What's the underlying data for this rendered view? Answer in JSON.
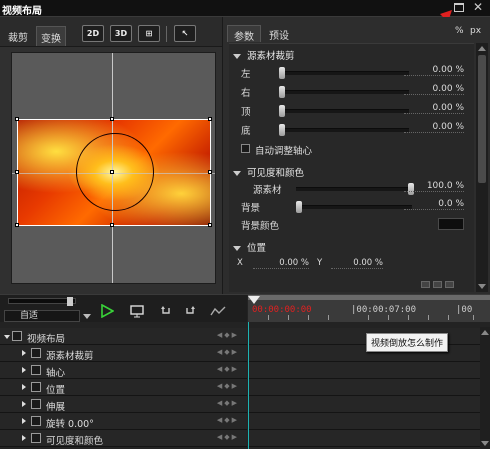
{
  "window": {
    "title": "视频布局",
    "close_glyph": "✕"
  },
  "left_tabs": [
    "裁剪",
    "变换"
  ],
  "view_buttons": [
    "2D",
    "3D",
    "⊞",
    "↖"
  ],
  "right_tabs": [
    "参数",
    "预设"
  ],
  "units": {
    "percent": "%",
    "px": "px"
  },
  "crop_section": {
    "title": "源素材裁剪",
    "rows": [
      {
        "label": "左",
        "value": "0.00 %"
      },
      {
        "label": "右",
        "value": "0.00 %"
      },
      {
        "label": "顶",
        "value": "0.00 %"
      },
      {
        "label": "底",
        "value": "0.00 %"
      }
    ],
    "auto_axis_label": "自动调整轴心"
  },
  "visibility_section": {
    "title": "可见度和颜色",
    "source_label": "源素材",
    "source_value": "100.0 %",
    "background_label": "背景",
    "background_value": "0.0 %",
    "background_color_label": "背景颜色"
  },
  "position_section": {
    "title": "位置",
    "x_label": "X",
    "x_value": "0.00 %",
    "y_label": "Y",
    "y_value": "0.00 %"
  },
  "timeline": {
    "fit_label": "自适",
    "timecode_start": "00:00:00:00",
    "timecode_mid": "|00:00:07:00",
    "timecode_end": "|00",
    "tracks": [
      {
        "name": "视频布局",
        "indent": 0,
        "open": true
      },
      {
        "name": "源素材裁剪",
        "indent": 1,
        "open": false
      },
      {
        "name": "轴心",
        "indent": 1,
        "open": false
      },
      {
        "name": "位置",
        "indent": 1,
        "open": false
      },
      {
        "name": "伸展",
        "indent": 1,
        "open": false
      },
      {
        "name": "旋转  0.00°",
        "indent": 1,
        "open": false
      },
      {
        "name": "可见度和颜色",
        "indent": 1,
        "open": false
      }
    ],
    "tooltip": "视频倒放怎么制作"
  },
  "colors": {
    "annotation_red": "#e02020",
    "playhead": "#1db3b3",
    "play_green": "#39d339"
  }
}
